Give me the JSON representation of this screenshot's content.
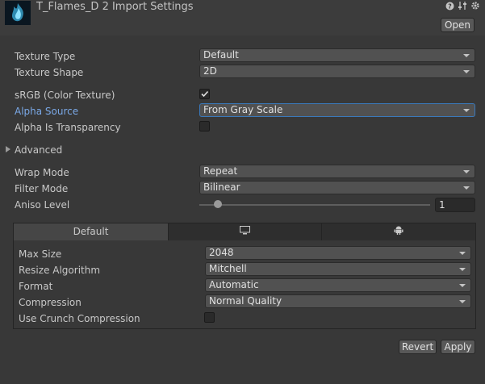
{
  "window": {
    "title": "T_Flames_D 2 Import Settings",
    "header_icons": [
      "help-icon",
      "sliders-icon",
      "gear-icon"
    ],
    "open_button": "Open"
  },
  "settings": {
    "texture_type": {
      "label": "Texture Type",
      "value": "Default"
    },
    "texture_shape": {
      "label": "Texture Shape",
      "value": "2D"
    },
    "srgb": {
      "label": "sRGB (Color Texture)",
      "checked": true
    },
    "alpha_source": {
      "label": "Alpha Source",
      "value": "From Gray Scale"
    },
    "alpha_is_transparency": {
      "label": "Alpha Is Transparency",
      "checked": false
    },
    "advanced": {
      "label": "Advanced",
      "expanded": false
    },
    "wrap_mode": {
      "label": "Wrap Mode",
      "value": "Repeat"
    },
    "filter_mode": {
      "label": "Filter Mode",
      "value": "Bilinear"
    },
    "aniso_level": {
      "label": "Aniso Level",
      "value": "1"
    }
  },
  "platform_tabs": [
    {
      "label": "Default",
      "icon": "default-tab",
      "active": true
    },
    {
      "label": "",
      "icon": "monitor-icon",
      "active": false
    },
    {
      "label": "",
      "icon": "android-icon",
      "active": false
    }
  ],
  "platform_settings": {
    "max_size": {
      "label": "Max Size",
      "value": "2048"
    },
    "resize_algorithm": {
      "label": "Resize Algorithm",
      "value": "Mitchell"
    },
    "format": {
      "label": "Format",
      "value": "Automatic"
    },
    "compression": {
      "label": "Compression",
      "value": "Normal Quality"
    },
    "use_crunch": {
      "label": "Use Crunch Compression",
      "checked": false
    }
  },
  "footer": {
    "revert": "Revert",
    "apply": "Apply"
  },
  "colors": {
    "background": "#383838",
    "label_highlight": "#7aa8e6",
    "focus_border": "#3a79bb"
  }
}
